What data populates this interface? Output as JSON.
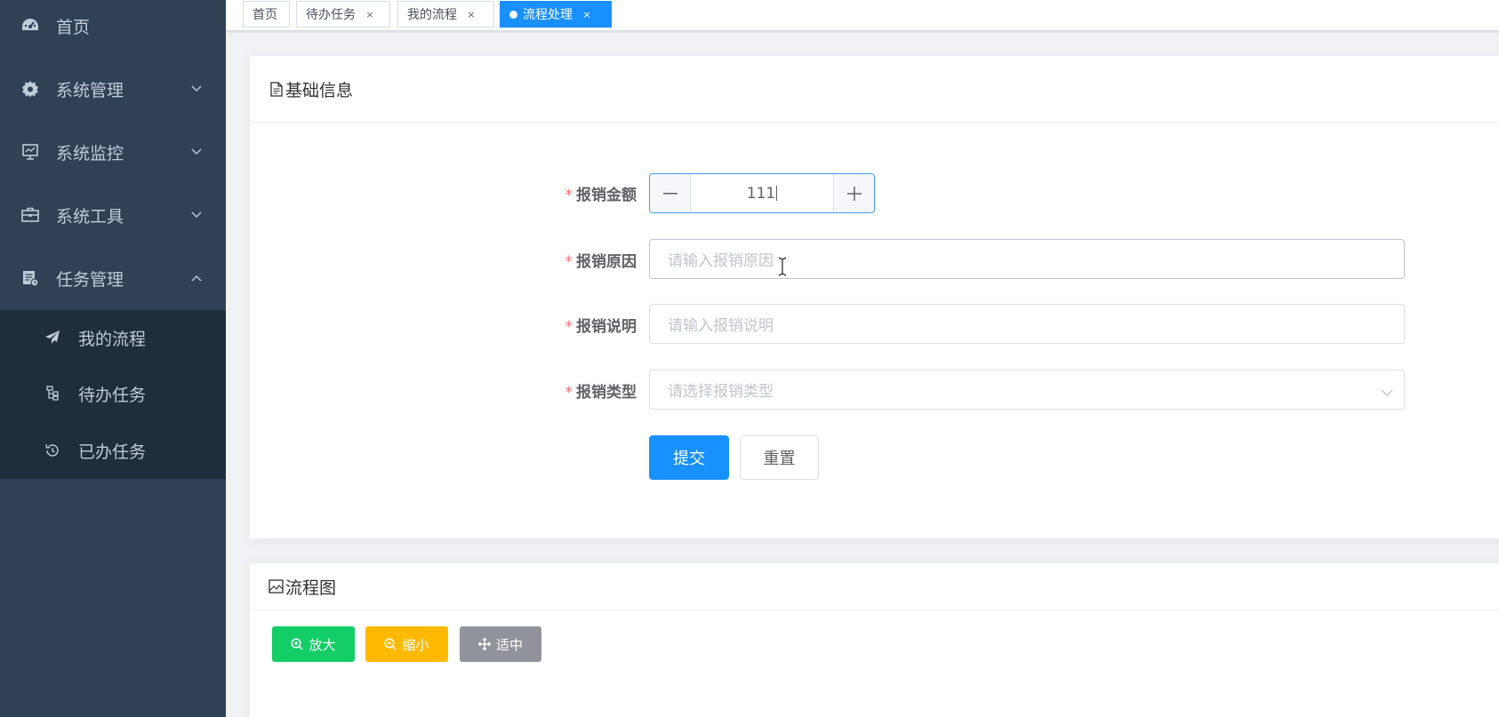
{
  "sidebar": {
    "items": [
      {
        "label": "首页",
        "icon": "dashboard-icon"
      },
      {
        "label": "系统管理",
        "icon": "gear-icon"
      },
      {
        "label": "系统监控",
        "icon": "monitor-icon"
      },
      {
        "label": "系统工具",
        "icon": "toolbox-icon"
      },
      {
        "label": "任务管理",
        "icon": "task-icon"
      }
    ],
    "submenu": [
      {
        "label": "我的流程",
        "icon": "paper-plane-icon"
      },
      {
        "label": "待办任务",
        "icon": "tree-icon"
      },
      {
        "label": "已办任务",
        "icon": "history-icon"
      }
    ]
  },
  "tags": [
    {
      "label": "首页"
    },
    {
      "label": "待办任务"
    },
    {
      "label": "我的流程"
    },
    {
      "label": "流程处理"
    }
  ],
  "tag_close": "×",
  "basic_info": {
    "title": "基础信息",
    "fields": {
      "amount": {
        "label": "报销金额",
        "value": "111"
      },
      "reason": {
        "label": "报销原因",
        "placeholder": "请输入报销原因"
      },
      "description": {
        "label": "报销说明",
        "placeholder": "请输入报销说明"
      },
      "type": {
        "label": "报销类型",
        "placeholder": "请选择报销类型"
      }
    },
    "required_mark": "*",
    "submit_label": "提交",
    "reset_label": "重置"
  },
  "flow_chart": {
    "title": "流程图",
    "zoom_in_label": "放大",
    "zoom_out_label": "缩小",
    "fit_label": "适中"
  },
  "colors": {
    "sidebar_bg": "#304156",
    "submenu_bg": "#1f2d3d",
    "primary": "#1890ff",
    "success": "#13ce66",
    "warning": "#ffba00",
    "info": "#909399",
    "danger": "#f56c6c"
  }
}
